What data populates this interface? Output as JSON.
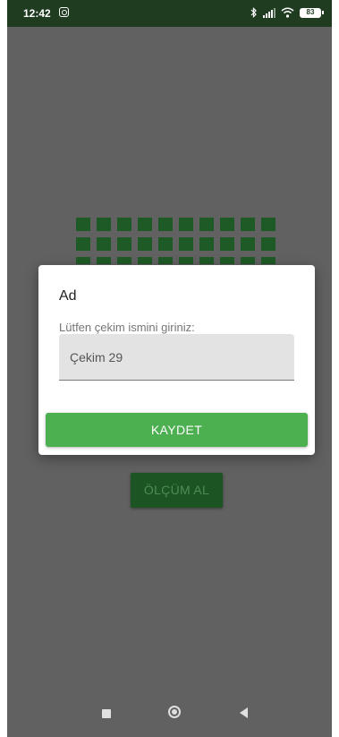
{
  "status_bar": {
    "time": "12:42",
    "battery": "83"
  },
  "background": {
    "measure_button_label": "ÖLÇÜM AL"
  },
  "dialog": {
    "title": "Ad",
    "prompt": "Lütfen çekim ismini giriniz:",
    "input_value": "Çekim 29",
    "save_label": "KAYDET"
  },
  "colors": {
    "status_bar": "#1f3c21",
    "overlay": "#616161",
    "accent_green": "#4caf50",
    "dark_green": "#1c5423"
  },
  "icons": {
    "status": [
      "instagram-icon",
      "bluetooth-icon",
      "signal-icon",
      "wifi-icon",
      "battery-icon"
    ],
    "nav": [
      "recent-apps-icon",
      "home-icon",
      "back-icon"
    ]
  }
}
